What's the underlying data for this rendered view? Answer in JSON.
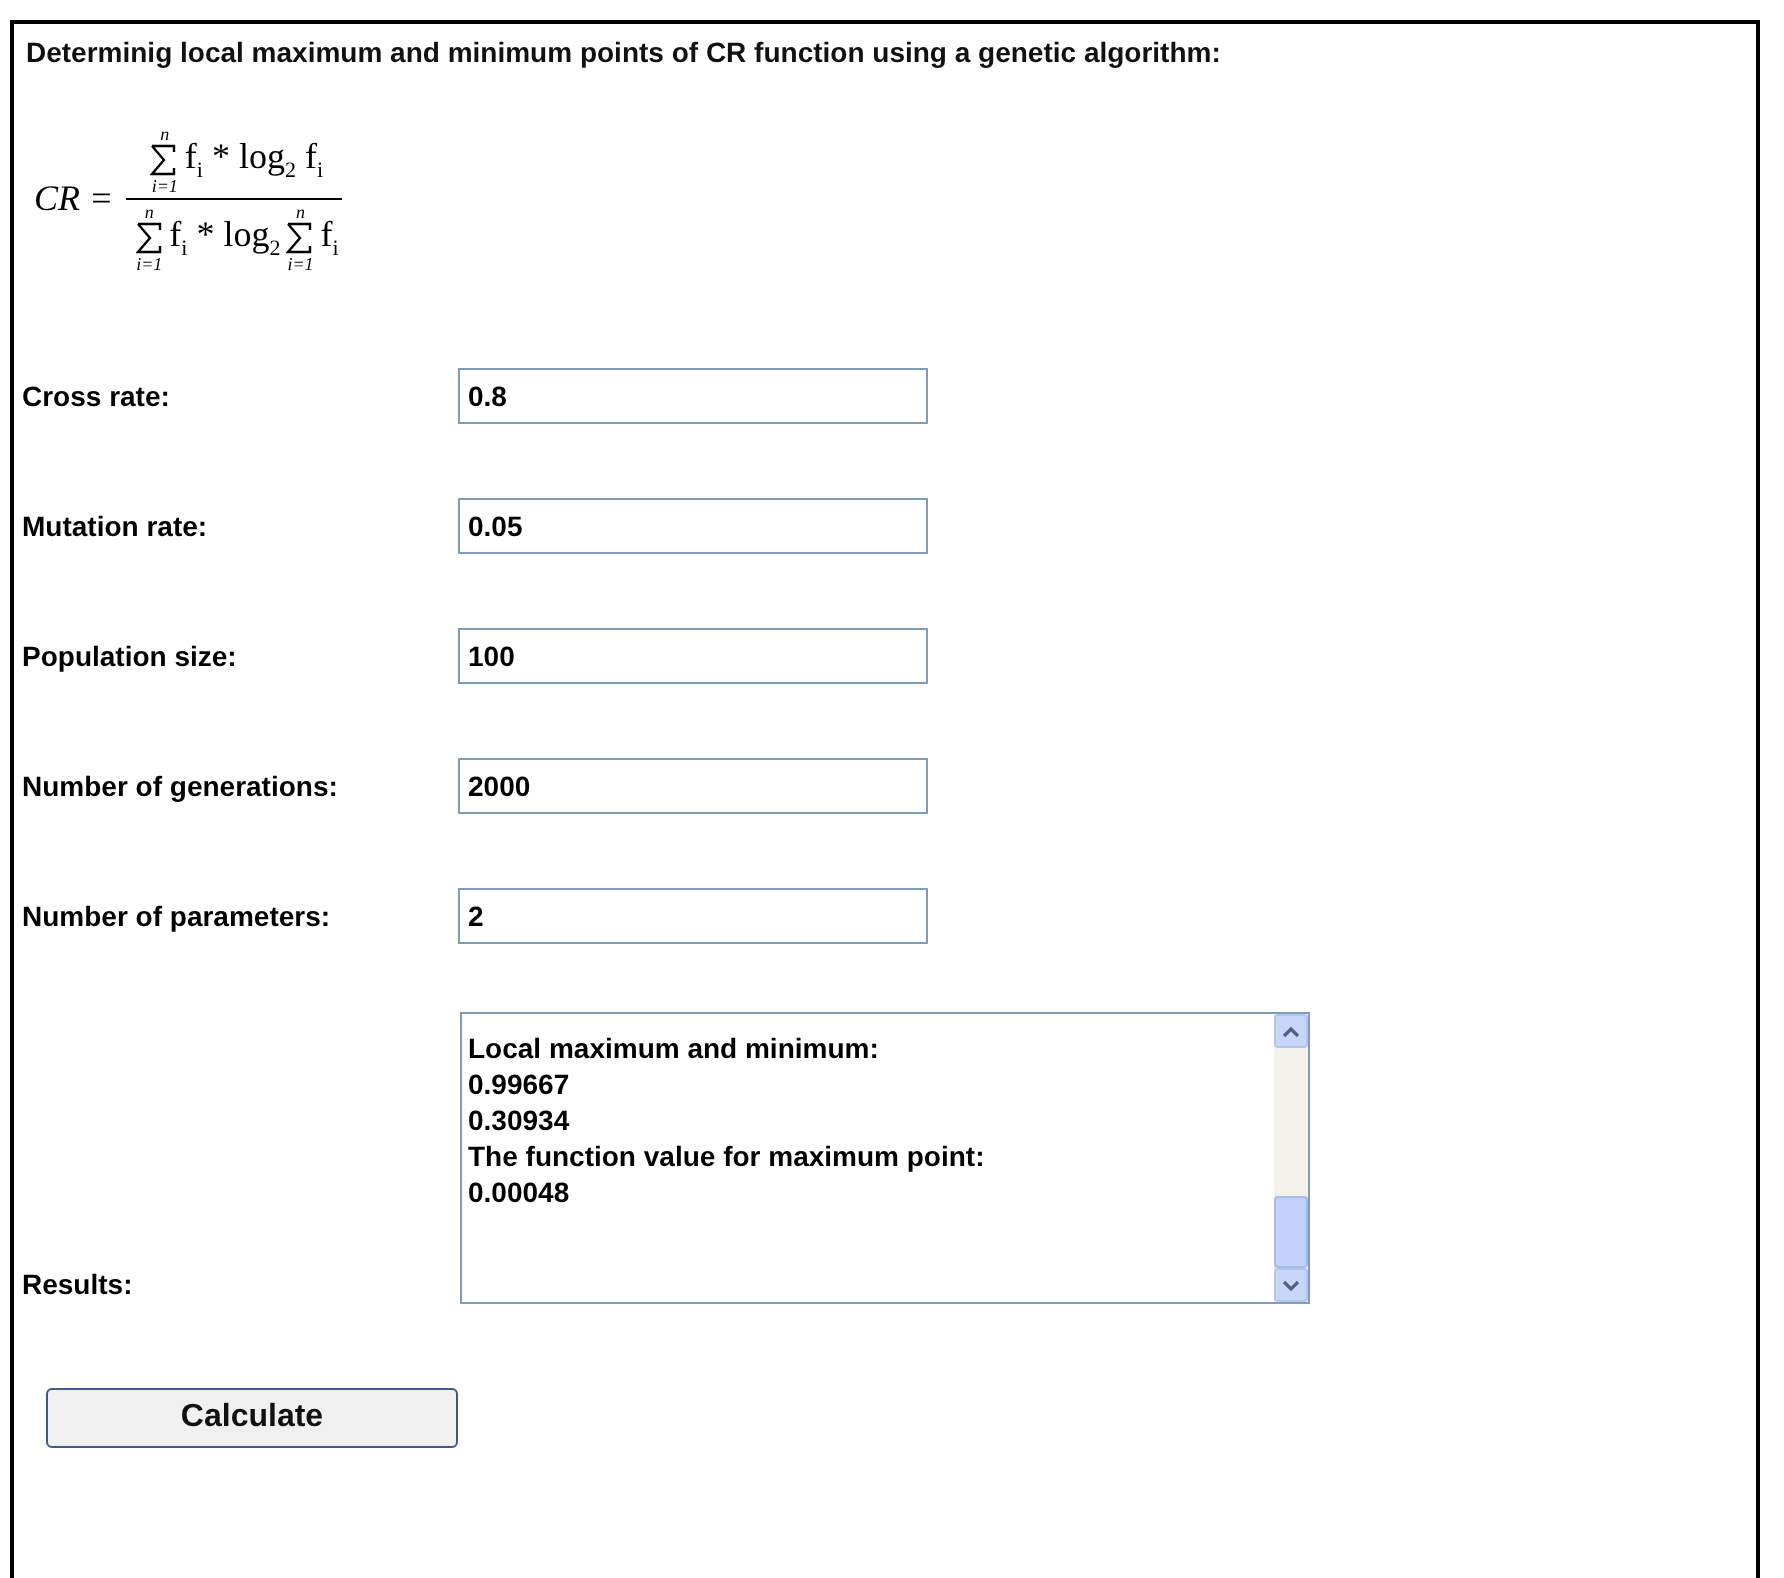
{
  "title": "Determinig local maximum and minimum points of CR function using a genetic algorithm:",
  "formula": {
    "lhs": "CR =",
    "numerator": [
      {
        "kind": "sum",
        "upper": "n",
        "lower": "i=1"
      },
      {
        "kind": "term",
        "text": "f$_{i}$ * log$_{2}$ f$_{i}$"
      }
    ],
    "denominator": [
      {
        "kind": "sum",
        "upper": "n",
        "lower": "i=1"
      },
      {
        "kind": "term",
        "text": "f$_{i}$ * log$_{2}$"
      },
      {
        "kind": "sum",
        "upper": "n",
        "lower": "i=1"
      },
      {
        "kind": "term",
        "text": "f$_{i}$"
      }
    ]
  },
  "fields": [
    {
      "label": "Cross rate:",
      "value": "0.8"
    },
    {
      "label": "Mutation rate:",
      "value": "0.05"
    },
    {
      "label": "Population size:",
      "value": "100"
    },
    {
      "label": "Number of generations:",
      "value": "2000"
    },
    {
      "label": "Number of parameters:",
      "value": "2"
    }
  ],
  "results": {
    "label": "Results:",
    "lines": [
      "Local maximum and minimum:",
      "0.99667",
      "0.30934",
      "The function value for maximum point:",
      "0.00048"
    ]
  },
  "button": "Calculate"
}
